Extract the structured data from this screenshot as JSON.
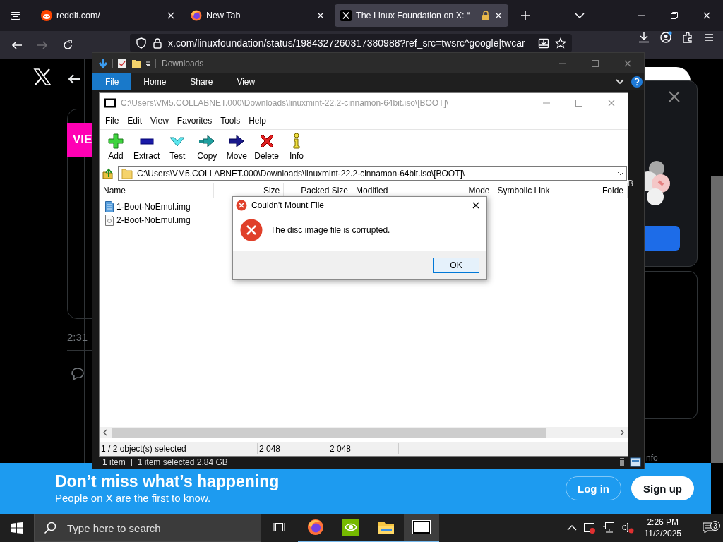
{
  "browser": {
    "tabs": [
      {
        "label": "reddit.com/",
        "kind": "reddit",
        "selected": false
      },
      {
        "label": "New Tab",
        "kind": "firefox",
        "selected": false
      },
      {
        "label": "The Linux Foundation on X: “",
        "kind": "x",
        "selected": true
      }
    ],
    "url": "x.com/linuxfoundation/status/1984327260317380988?ref_src=twsrc^google|twcar"
  },
  "x_page": {
    "promo_label": "VIE",
    "timestamp": "2:31",
    "footer_fragment": "nfo",
    "banner": {
      "title": "Don’t miss what’s happening",
      "subtitle": "People on X are the first to know.",
      "buttons": [
        {
          "label": "Log in",
          "kind": "outline"
        },
        {
          "label": "Sign up",
          "kind": "filled"
        }
      ]
    }
  },
  "explorer": {
    "title": "Downloads",
    "ribbon_tabs": [
      {
        "label": "File",
        "selected": true
      },
      {
        "label": "Home",
        "selected": false
      },
      {
        "label": "Share",
        "selected": false
      },
      {
        "label": "View",
        "selected": false
      }
    ],
    "side_fragment": "B",
    "status": [
      "1 item",
      "1 item selected  2.84 GB"
    ]
  },
  "sevenzip": {
    "title": "C:\\Users\\VM5.COLLABNET.000\\Downloads\\linuxmint-22.2-cinnamon-64bit.iso\\[BOOT]\\",
    "menu": [
      "File",
      "Edit",
      "View",
      "Favorites",
      "Tools",
      "Help"
    ],
    "toolbar": [
      {
        "label": "Add",
        "kind": "add"
      },
      {
        "label": "Extract",
        "kind": "extract"
      },
      {
        "label": "Test",
        "kind": "test"
      },
      {
        "label": "Copy",
        "kind": "copy"
      },
      {
        "label": "Move",
        "kind": "move"
      },
      {
        "label": "Delete",
        "kind": "delete"
      },
      {
        "label": "Info",
        "kind": "info"
      }
    ],
    "path": "C:\\Users\\VM5.COLLABNET.000\\Downloads\\linuxmint-22.2-cinnamon-64bit.iso\\[BOOT]\\",
    "columns": [
      "Name",
      "Size",
      "Packed Size",
      "Modified",
      "Mode",
      "Symbolic Link",
      "Folde"
    ],
    "files": [
      {
        "name": "1-Boot-NoEmul.img",
        "kind": "image"
      },
      {
        "name": "2-Boot-NoEmul.img",
        "kind": "document"
      }
    ],
    "status": [
      "1 / 2 object(s) selected",
      "2 048",
      "2 048"
    ]
  },
  "dialog": {
    "title": "Couldn't Mount File",
    "message": "The disc image file is corrupted.",
    "button": "OK"
  },
  "taskbar": {
    "search_placeholder": "Type here to search",
    "apps": [
      {
        "kind": "taskview",
        "selected": false
      },
      {
        "kind": "firefox",
        "selected": false
      },
      {
        "kind": "nvidia",
        "selected": false
      },
      {
        "kind": "folder",
        "selected": false
      },
      {
        "kind": "archive",
        "selected": true
      }
    ],
    "time": "2:26 PM",
    "date": "11/2/2025",
    "notifications": "3"
  }
}
